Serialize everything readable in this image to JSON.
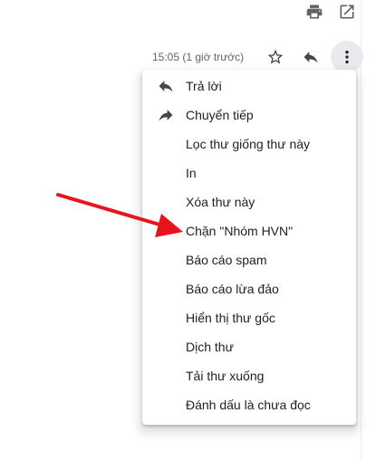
{
  "header": {
    "print_icon": "print-icon",
    "open_new_window_icon": "open-in-new-window-icon"
  },
  "message": {
    "timestamp": "15:05 (1 giờ trước)",
    "star_icon": "star-outline-icon",
    "reply_icon": "reply-icon",
    "more_icon": "more-vertical-icon"
  },
  "menu": {
    "items": [
      {
        "label": "Trả lời",
        "icon": "reply-icon"
      },
      {
        "label": "Chuyển tiếp",
        "icon": "forward-icon"
      },
      {
        "label": "Lọc thư giống thư này",
        "icon": ""
      },
      {
        "label": "In",
        "icon": ""
      },
      {
        "label": "Xóa thư này",
        "icon": ""
      },
      {
        "label": "Chặn \"Nhóm HVN\"",
        "icon": ""
      },
      {
        "label": "Báo cáo spam",
        "icon": ""
      },
      {
        "label": "Báo cáo lừa đảo",
        "icon": ""
      },
      {
        "label": "Hiển thị thư gốc",
        "icon": ""
      },
      {
        "label": "Dịch thư",
        "icon": ""
      },
      {
        "label": "Tải thư xuống",
        "icon": ""
      },
      {
        "label": "Đánh dấu là chưa đọc",
        "icon": ""
      }
    ]
  },
  "annotation": {
    "arrow_color": "#e8141c",
    "points_to": "Chặn \"Nhóm HVN\""
  }
}
